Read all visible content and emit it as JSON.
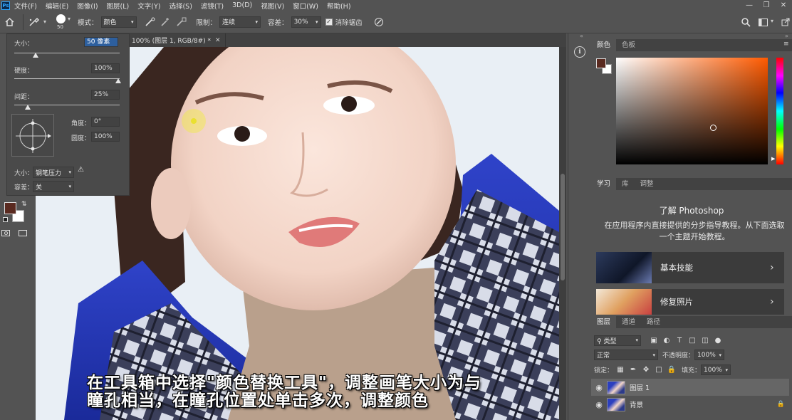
{
  "menubar": {
    "logo": "Ps",
    "items": [
      "文件(F)",
      "编辑(E)",
      "图像(I)",
      "图层(L)",
      "文字(Y)",
      "选择(S)",
      "滤镜(T)",
      "3D(D)",
      "视图(V)",
      "窗口(W)",
      "帮助(H)"
    ]
  },
  "options": {
    "brush_size_badge": "50",
    "mode_label": "模式：",
    "mode_value": "颜色",
    "limit_label": "限制：",
    "limit_value": "连续",
    "tolerance_label": "容差：",
    "tolerance_value": "30%",
    "antialias_label": "消除锯齿",
    "antialias_checked": true
  },
  "brush_popup": {
    "size_label": "大小：",
    "size_value": "50 像素",
    "size_fraction": 0.2,
    "hardness_label": "硬度：",
    "hardness_value": "100%",
    "spacing_label": "间距：",
    "spacing_value": "25%",
    "angle_label": "角度：",
    "angle_value": "0°",
    "roundness_label": "圆度：",
    "roundness_value": "100%",
    "size_ctrl_label": "大小：",
    "size_ctrl_value": "钢笔压力",
    "tolerance_label": "容差：",
    "tolerance_value": "关"
  },
  "document": {
    "tab_title": "100% (图层 1, RGB/8#) *",
    "caption_line1": "在工具箱中选择\"颜色替换工具\"，调整画笔大小为与",
    "caption_line2": "瞳孔相当，在瞳孔位置处单击多次，调整颜色"
  },
  "colors": {
    "foreground": "#5a2a20",
    "background": "#ffffff",
    "accent": "#ff5a00"
  },
  "color_panel": {
    "tabs": [
      "颜色",
      "色板"
    ]
  },
  "learn_panel": {
    "tabs": [
      "学习",
      "库",
      "调整"
    ],
    "title": "了解 Photoshop",
    "description": "在应用程序内直接提供的分步指导教程。从下面选取一个主题开始教程。",
    "cards": [
      "基本技能",
      "修复照片"
    ]
  },
  "layers_panel": {
    "tabs": [
      "图层",
      "通道",
      "路径"
    ],
    "kind_filter": "类型",
    "blend_mode": "正常",
    "opacity_label": "不透明度：",
    "opacity_value": "100%",
    "lock_label": "锁定：",
    "fill_label": "填充：",
    "fill_value": "100%",
    "layers": [
      "图层 1",
      "背景"
    ]
  }
}
